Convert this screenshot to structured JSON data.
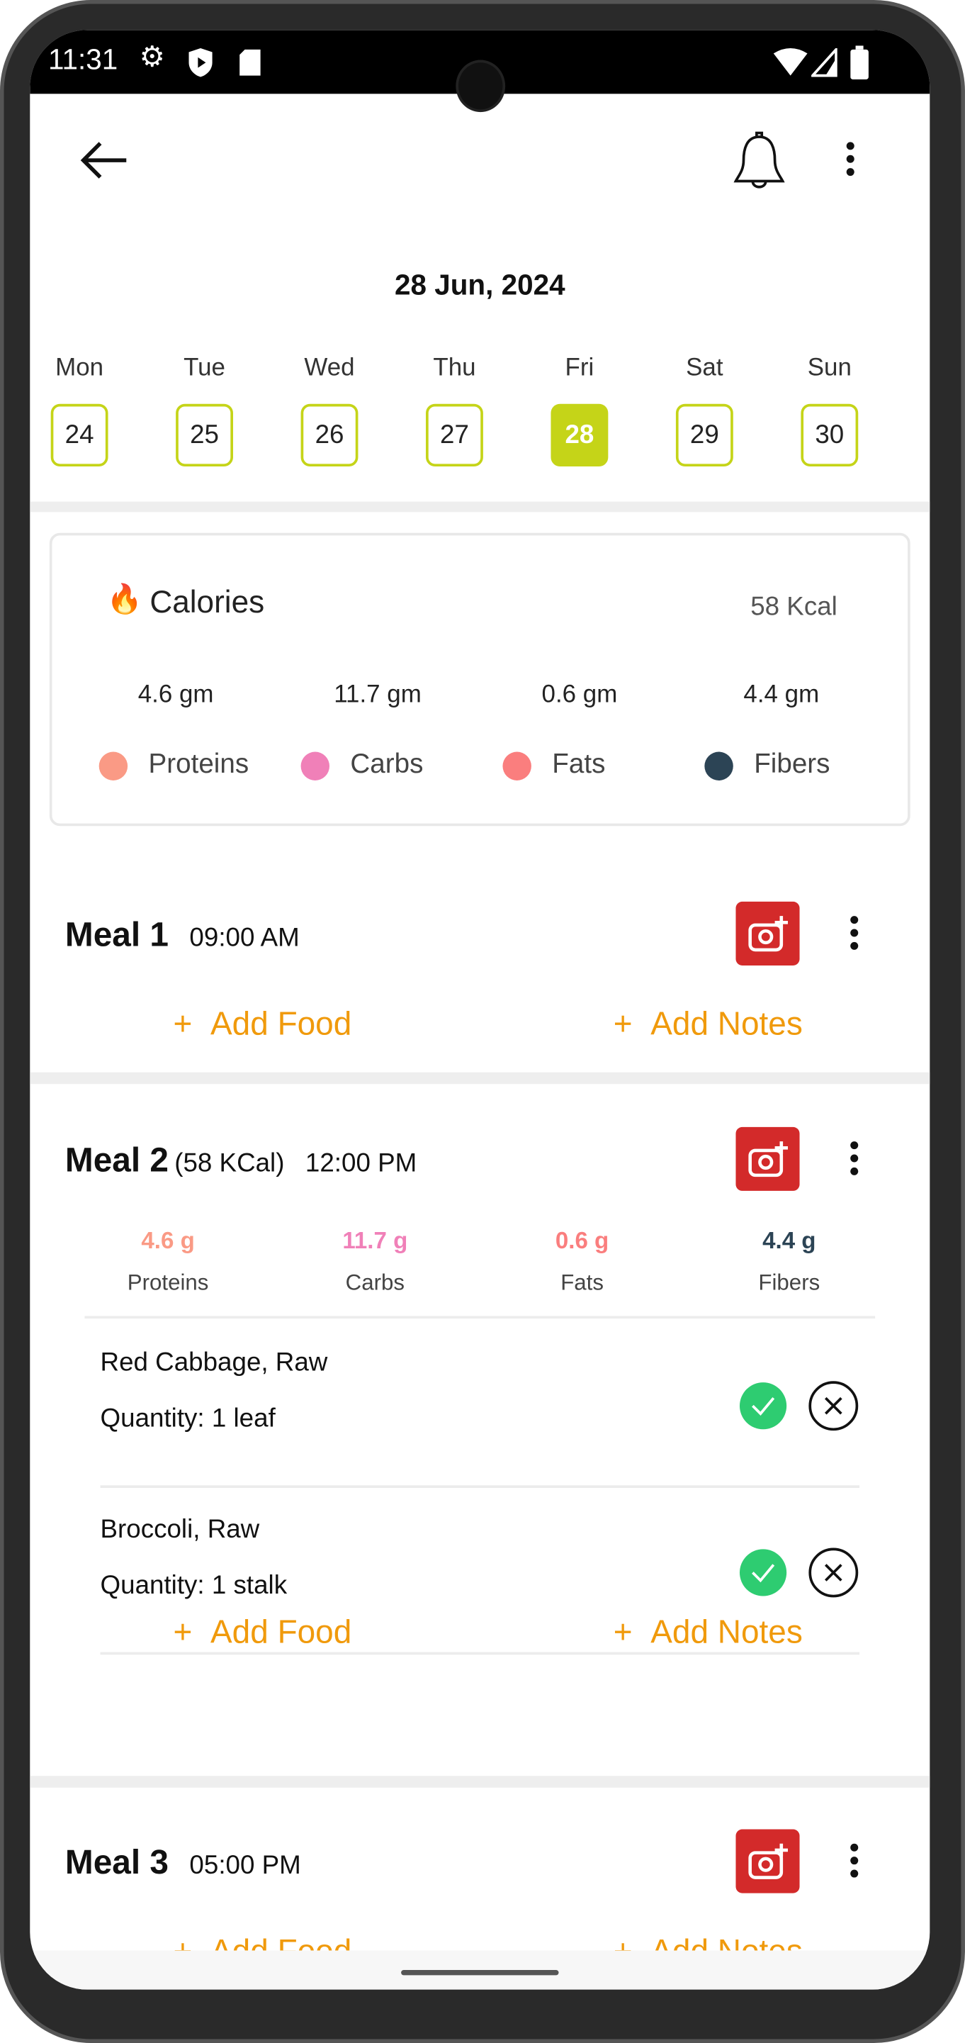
{
  "status_bar": {
    "time": "11:31",
    "icons": [
      "gear-icon",
      "shield-play-icon",
      "sd-card-icon",
      "wifi-icon",
      "signal-icon",
      "battery-icon"
    ]
  },
  "header": {
    "back_icon": "arrow-left-icon",
    "bell_icon": "bell-icon",
    "menu_icon": "more-vertical-icon"
  },
  "date": "28 Jun, 2024",
  "week": [
    {
      "day": "Mon",
      "date": "24"
    },
    {
      "day": "Tue",
      "date": "25"
    },
    {
      "day": "Wed",
      "date": "26"
    },
    {
      "day": "Thu",
      "date": "27"
    },
    {
      "day": "Fri",
      "date": "28",
      "selected": true
    },
    {
      "day": "Sat",
      "date": "29"
    },
    {
      "day": "Sun",
      "date": "30"
    }
  ],
  "accent_color": "#c5d418",
  "calories": {
    "icon": "🔥",
    "label": "Calories",
    "value": "58 Kcal",
    "macros": [
      {
        "value": "4.6 gm",
        "label": "Proteins",
        "color": "#fa9a85"
      },
      {
        "value": "11.7 gm",
        "label": "Carbs",
        "color": "#f080b8"
      },
      {
        "value": "0.6 gm",
        "label": "Fats",
        "color": "#fa7e7e"
      },
      {
        "value": "4.4 gm",
        "label": "Fibers",
        "color": "#2c4455"
      }
    ]
  },
  "meals": [
    {
      "title": "Meal 1",
      "time": "09:00 AM",
      "add_food": "Add Food",
      "add_notes": "Add Notes"
    },
    {
      "title": "Meal 2",
      "kcal": "(58 KCal)",
      "time": "12:00 PM",
      "macros": [
        {
          "value": "4.6 g",
          "label": "Proteins",
          "color": "#fa9a85"
        },
        {
          "value": "11.7 g",
          "label": "Carbs",
          "color": "#f080b8"
        },
        {
          "value": "0.6 g",
          "label": "Fats",
          "color": "#fa7e7e"
        },
        {
          "value": "4.4 g",
          "label": "Fibers",
          "color": "#2c4455"
        }
      ],
      "foods": [
        {
          "name": "Red Cabbage, Raw",
          "quantity": "Quantity: 1 leaf"
        },
        {
          "name": "Broccoli, Raw",
          "quantity": "Quantity: 1 stalk"
        }
      ],
      "add_food": "Add Food",
      "add_notes": "Add Notes"
    },
    {
      "title": "Meal 3",
      "time": "05:00 PM",
      "add_food": "Add Food",
      "add_notes": "Add Notes"
    }
  ],
  "plus": "+"
}
